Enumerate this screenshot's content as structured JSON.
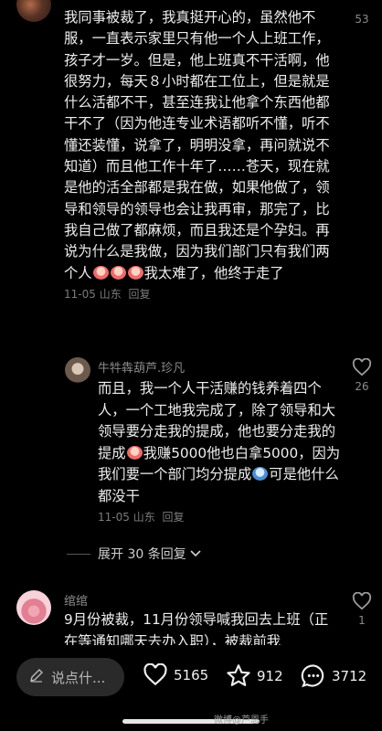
{
  "comment1": {
    "text_a": "我同事被裁了，我真挺开心的，虽然他不服，一直表示家里只有他一个人上班工作，孩子才一岁。但是，他上班真不干活啊，他很努力，每天８小时都在工位上，但是就是什么活都不干，甚至连我让他拿个东西他都干不了（因为他连专业术语都听不懂，听不懂还装懂，说拿了，明明没拿，再问就说不知道）而且他工作十年了……苍天，现在就是他的活全部都是我在做，如果他做了，领导和领导的领导也会让我再审，那完了，比我自己做了都麻烦，而且我还是个孕妇。再说为什么是我做，因为我们部门只有我们两个人",
    "text_b": "我太难了，他终于走了",
    "date": "11-05",
    "location": "山东",
    "reply_label": "回复",
    "like_count": "53"
  },
  "reply1": {
    "username": "牛牪犇葫芦.珍凡",
    "text_a": "而且，我一个人干活赚的钱养着四个人，一个工地我完成了，除了领导和大领导要分走我的提成，他也要分走我的提成",
    "text_b": "我赚5000他也白拿5000，因为我们要一个部门均分提成",
    "text_c": "可是他什么都没干",
    "date": "11-05",
    "location": "山东",
    "reply_label": "回复",
    "like_count": "26"
  },
  "expand_label": "展开 30 条回复",
  "comment2": {
    "username": "绾绾",
    "text": "9月份被裁，11月份领导喊我回去上班（正在等通知哪天去办入职），被裁前我",
    "like_count": "1"
  },
  "bottom": {
    "input_placeholder": "说点什...",
    "likes": "5165",
    "favorites": "912",
    "comments": "3712"
  },
  "watermark": "微博@芦恩手"
}
